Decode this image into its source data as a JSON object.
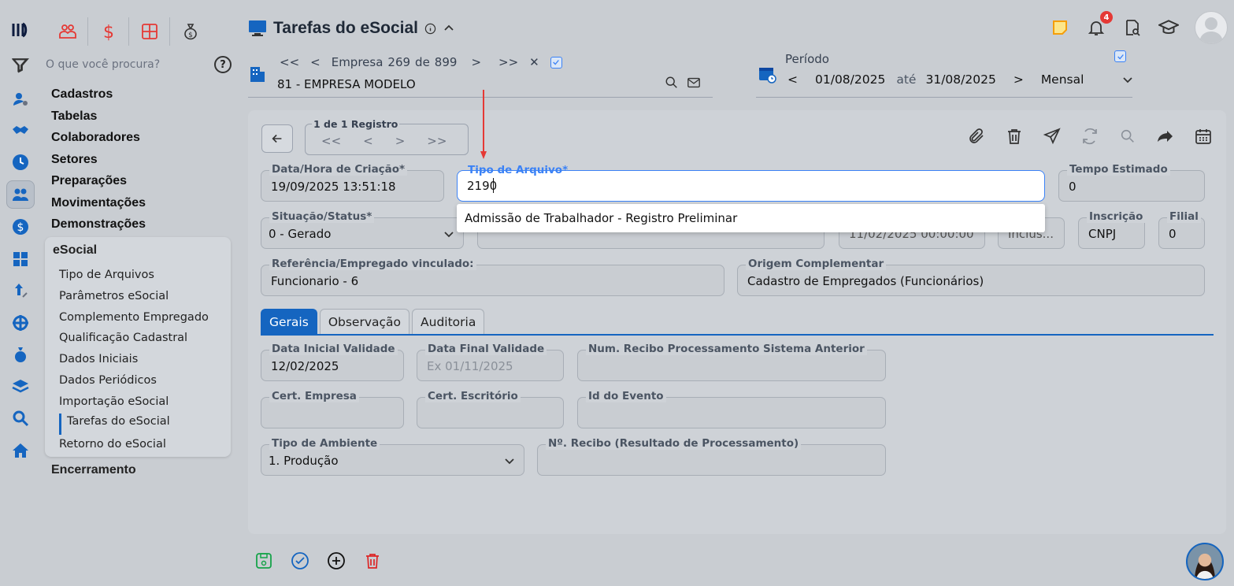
{
  "search": {
    "placeholder": "O que você procura?"
  },
  "help_label": "?",
  "menu": {
    "heads": [
      "Cadastros",
      "Tabelas",
      "Colaboradores",
      "Setores",
      "Preparações",
      "Movimentações",
      "Demonstrações"
    ],
    "esocial_title": "eSocial",
    "esocial_items": [
      "Tipo de Arquivos",
      "Parâmetros eSocial",
      "Complemento Empregado",
      "Qualificação Cadastral",
      "Dados Iniciais",
      "Dados Periódicos",
      "Importação eSocial",
      "Tarefas do eSocial",
      "Retorno do eSocial"
    ],
    "active_item": "Tarefas do eSocial",
    "tail": "Encerramento"
  },
  "header": {
    "title": "Tarefas do eSocial",
    "notifications_count": "4"
  },
  "company": {
    "empresa_label": "Empresa",
    "current": "269",
    "de": "de",
    "total": "899",
    "name": "81 - EMPRESA MODELO"
  },
  "period": {
    "label": "Período",
    "start": "01/08/2025",
    "ate": "até",
    "end": "31/08/2025",
    "mode": "Mensal"
  },
  "record": {
    "label": "1 de 1 Registro"
  },
  "fields": {
    "data_hora_label": "Data/Hora de Criação*",
    "data_hora_value": "19/09/2025 13:51:18",
    "tipo_arquivo_label": "Tipo de Arquivo*",
    "tipo_arquivo_value": "2190",
    "tempo_label": "Tempo Estimado",
    "tempo_value": "0",
    "situacao_label": "Situação/Status*",
    "situacao_value": "0 - Gerado",
    "partial_date_value": "11/02/2025 00:00:00",
    "partial_inclus_value": "Inclus...",
    "inscricao_label": "Inscrição",
    "inscricao_value": "CNPJ",
    "filial_label": "Filial",
    "filial_value": "0",
    "referencia_label": "Referência/Empregado vinculado:",
    "referencia_value": "Funcionario - 6",
    "origem_label": "Origem Complementar",
    "origem_value": "Cadastro de Empregados (Funcionários)"
  },
  "dropdown": {
    "option": "Admissão de Trabalhador - Registro Preliminar"
  },
  "tabs": [
    "Gerais",
    "Observação",
    "Auditoria"
  ],
  "gerais": {
    "data_inicial_label": "Data Inicial Validade",
    "data_inicial_value": "12/02/2025",
    "data_final_label": "Data Final Validade",
    "data_final_placeholder": "Ex 01/11/2025",
    "num_recibo_label": "Num. Recibo Processamento Sistema Anterior",
    "cert_empresa_label": "Cert. Empresa",
    "cert_escritorio_label": "Cert. Escritório",
    "id_evento_label": "Id do Evento",
    "tipo_ambiente_label": "Tipo de Ambiente",
    "tipo_ambiente_value": "1. Produção",
    "n_recibo_label": "Nº. Recibo (Resultado de Processamento)"
  },
  "colors": {
    "accent": "#1565c0",
    "annotation": "#e53935",
    "save": "#16a34a",
    "delete": "#dc2626"
  }
}
